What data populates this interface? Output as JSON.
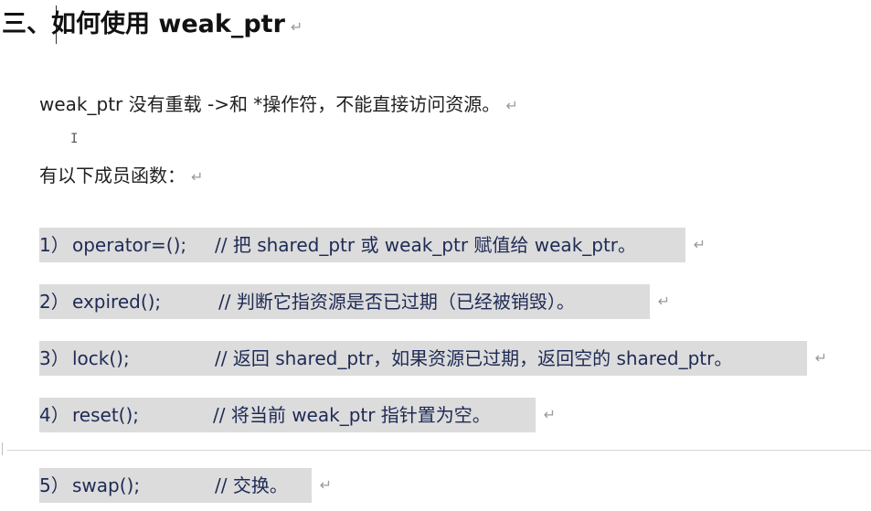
{
  "heading": {
    "text": "三、如何使用 weak_ptr"
  },
  "intro": {
    "text": "weak_ptr 没有重载 ->和 *操作符，不能直接访问资源。"
  },
  "members_heading": {
    "text": "有以下成员函数："
  },
  "members": [
    {
      "num": "1）",
      "fn": "operator=();",
      "comment": "// 把 shared_ptr 或 weak_ptr 赋值给 weak_ptr。"
    },
    {
      "num": "2）",
      "fn": "expired();",
      "comment": "// 判断它指资源是否已过期（已经被销毁）。"
    },
    {
      "num": "3）",
      "fn": "lock();",
      "comment": "// 返回 shared_ptr，如果资源已过期，返回空的 shared_ptr。"
    },
    {
      "num": "4）",
      "fn": "reset();",
      "comment": "// 将当前 weak_ptr 指针置为空。"
    },
    {
      "num": "5）",
      "fn": "swap();",
      "comment": "// 交换。"
    }
  ],
  "paragraph_mark": "↵",
  "ibeam_glyph": "I"
}
